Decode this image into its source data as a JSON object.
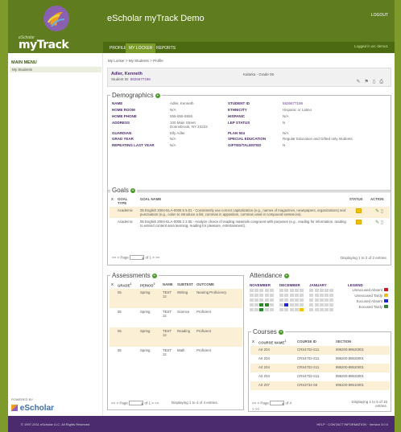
{
  "app": {
    "title": "eScholar myTrack Demo",
    "logo_small": "eScholar",
    "logo_text": "myTrack",
    "logout": "LOGOUT",
    "logged_in": "Logged in as: demo1"
  },
  "nav": [
    "PROFILE",
    "MY LOCKER",
    "REPORTS"
  ],
  "sidebar": {
    "title": "MAIN MENU",
    "items": [
      "My Students"
    ],
    "powered_by": "POWERED BY",
    "brand": "eScholar",
    "brand_sub": "We know education data"
  },
  "breadcrumb": "My Locker > My Students > Profile",
  "student": {
    "name": "Adler, Kenneth",
    "id_label": "Student ID:",
    "id": "5826677198",
    "school": "Kalarka - Grade 05"
  },
  "demographics": {
    "title": "Demographics",
    "left": [
      {
        "label": "NAME",
        "value": "Adler, Kenneth"
      },
      {
        "label": "HOME ROOM",
        "value": "N/A"
      },
      {
        "label": "HOME PHONE",
        "value": "555-555-5555"
      },
      {
        "label": "ADDRESS",
        "value": "100 Main Street\nDonnsbrook, NY 22222"
      },
      {
        "label": "GUARDIAN",
        "value": "Elly Adler"
      },
      {
        "label": "GRAD YEAR",
        "value": "N/A"
      },
      {
        "label": "REPEATING LAST YEAR",
        "value": "N/A"
      }
    ],
    "right": [
      {
        "label": "STUDENT ID",
        "value": "5826677198"
      },
      {
        "label": "ETHNICITY",
        "value": "Hispanic or Latino"
      },
      {
        "label": "HISPANIC",
        "value": "N/A"
      },
      {
        "label": "LEP STATUS",
        "value": "N"
      },
      {
        "label": "PLAN 504",
        "value": "N/A"
      },
      {
        "label": "SPECIAL EDUCATION",
        "value": "Regular Education and Gifted only students"
      },
      {
        "label": "GIFTED/TALENTED",
        "value": "N"
      }
    ]
  },
  "goals": {
    "title": "Goals",
    "headers": [
      "X",
      "GOAL TYPE",
      "GOAL NAME",
      "STATUS",
      "ACTION"
    ],
    "rows": [
      {
        "type": "Academic",
        "name": "05 English 2004-ELA-0005 5 5.01 - Consistently use correct capitalization (e.g., names of magazines, newspapers, organizations) and punctuation (e.g., colon to introduce a list, commas in apposition, commas used in compound sentences)."
      },
      {
        "type": "Academic",
        "name": "05 English 2004-ELA-0005 2 2.05 - Analyze choice of reading materials congruent with purposes (e.g., reading for information, reading to extend content area learning, reading for pleasure, entertainment)."
      }
    ],
    "pager_prev": "<< < Page",
    "page": "1",
    "pager_next": "of 1 > >>",
    "display": "Displaying 1 to 2 of 2 entries."
  },
  "assessments": {
    "title": "Assessments",
    "headers": [
      "X",
      "GRADE",
      "PERIOD",
      "NAME",
      "SUBTEST",
      "OUTCOME"
    ],
    "sort_marks": [
      "1",
      "2"
    ],
    "rows": [
      {
        "grade": "05",
        "period": "Spring",
        "name": "TEST 12",
        "subtest": "Writing",
        "outcome": "Nearing Proficiency"
      },
      {
        "grade": "05",
        "period": "Spring",
        "name": "TEST 12",
        "subtest": "Science",
        "outcome": "Proficient"
      },
      {
        "grade": "05",
        "period": "Spring",
        "name": "TEST 12",
        "subtest": "Reading",
        "outcome": "Proficient"
      },
      {
        "grade": "05",
        "period": "Spring",
        "name": "TEST 12",
        "subtest": "Math",
        "outcome": "Proficient"
      }
    ],
    "pager_prev": "<< < Page",
    "page": "1",
    "pager_next": "of 1 > >>",
    "display": "Displaying 1 to 4 of 4 entries."
  },
  "attendance": {
    "title": "Attendance",
    "months": [
      "NOVEMBER",
      "DECEMBER",
      "JANUARY"
    ],
    "legend_title": "LEGEND",
    "legend": [
      {
        "label": "Unexcused Absent",
        "color": "#d81818"
      },
      {
        "label": "Unexcused Tardy",
        "color": "#f2c200"
      },
      {
        "label": "Excused Absent",
        "color": "#1a2ad8"
      },
      {
        "label": "Excused Tardy",
        "color": "#2a8a2a"
      }
    ]
  },
  "courses": {
    "title": "Courses",
    "headers": [
      "X",
      "COURSE NAME",
      "COURSE ID",
      "SECTION"
    ],
    "sort_mark": "1",
    "rows": [
      {
        "name": "Art 204",
        "id": "CRS4702-S11",
        "section": "895200-89520001"
      },
      {
        "name": "Art 204",
        "id": "CRS4702-S11",
        "section": "895200-89520001"
      },
      {
        "name": "Art 204",
        "id": "CRS4702-S11",
        "section": "895200-89520001"
      },
      {
        "name": "Art 204",
        "id": "CRS4702-S11",
        "section": "895200-89520001"
      },
      {
        "name": "Art 207",
        "id": "CRS3734-S6",
        "section": "895100-89510001"
      }
    ],
    "pager_prev": "<< < Page",
    "page": "1",
    "pager_next": "of 4",
    "pager_last": "> >>",
    "display": "Displaying 1 to 5 of 16 entries."
  },
  "footer": {
    "copyright": "© 1997-2011 eScholar LLC. All Rights Reserved",
    "right": "HELP · CONTACT INFORMATION · Version 3.0.0"
  }
}
